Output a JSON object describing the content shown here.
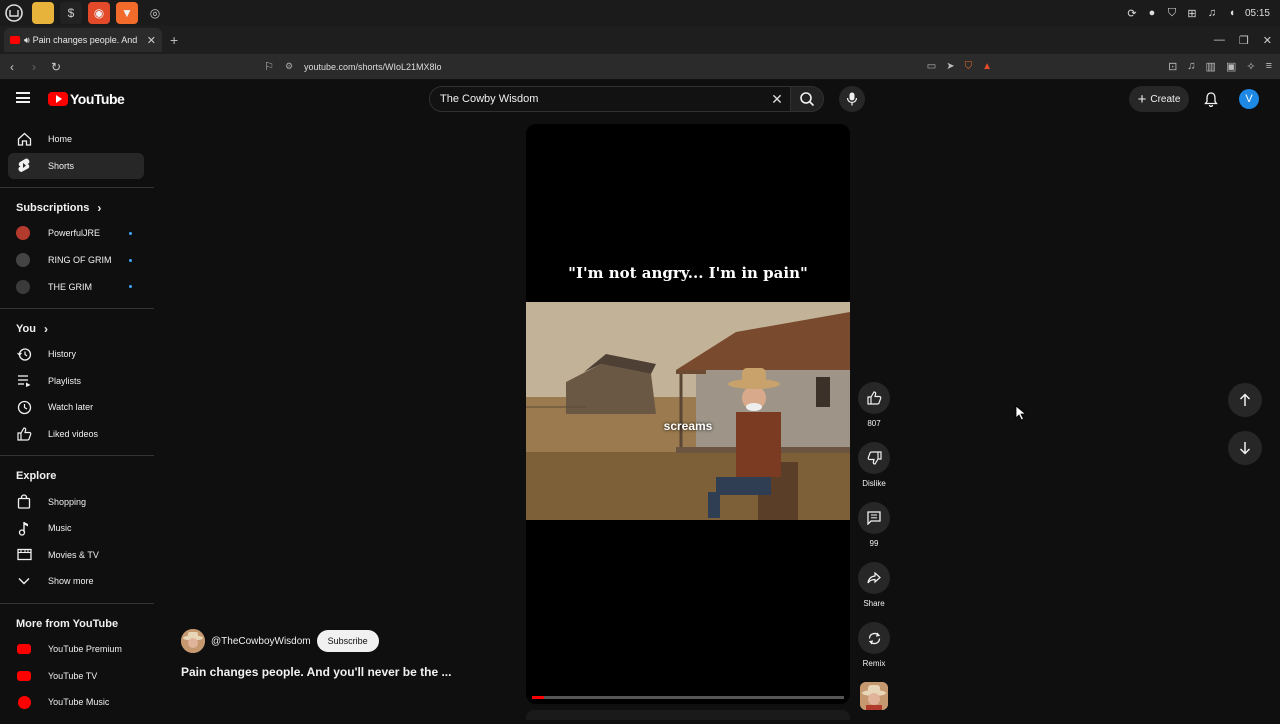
{
  "os": {
    "time": "05:15",
    "launcher_icon": "mint-logo-icon",
    "apps": [
      "folder-icon",
      "terminal-icon",
      "app-icon",
      "brave-icon",
      "chromium-icon"
    ]
  },
  "browser": {
    "tab_title": "Pain changes people. And",
    "url": "youtube.com/shorts/WIoL21MX8lo",
    "new_tab": "+"
  },
  "header": {
    "logo_text": "YouTube",
    "search_value": "The Cowby Wisdom",
    "create_label": "Create",
    "avatar_letter": "V"
  },
  "sidebar": {
    "main": [
      {
        "label": "Home",
        "icon": "home-icon"
      },
      {
        "label": "Shorts",
        "icon": "shorts-icon"
      }
    ],
    "subs_heading": "Subscriptions",
    "subs": [
      {
        "label": "PowerfulJRE",
        "color": "#b33a2c"
      },
      {
        "label": "RING OF GRIM",
        "color": "#444444"
      },
      {
        "label": "THE GRIM",
        "color": "#3a3a3a"
      }
    ],
    "you_heading": "You",
    "you": [
      {
        "label": "History",
        "icon": "history-icon"
      },
      {
        "label": "Playlists",
        "icon": "playlists-icon"
      },
      {
        "label": "Watch later",
        "icon": "clock-icon"
      },
      {
        "label": "Liked videos",
        "icon": "thumbs-up-icon"
      }
    ],
    "explore_heading": "Explore",
    "explore": [
      {
        "label": "Shopping",
        "icon": "bag-icon"
      },
      {
        "label": "Music",
        "icon": "music-icon"
      },
      {
        "label": "Movies & TV",
        "icon": "film-icon"
      },
      {
        "label": "Show more",
        "icon": "chevron-down-icon"
      }
    ],
    "more_heading": "More from YouTube",
    "more": [
      {
        "label": "YouTube Premium"
      },
      {
        "label": "YouTube TV"
      },
      {
        "label": "YouTube Music"
      }
    ]
  },
  "short": {
    "quote": "\"I'm not angry... I'm in pain\"",
    "caption": "screams",
    "progress": 0.04,
    "channel": "@TheCowboyWisdom",
    "subscribe": "Subscribe",
    "title": "Pain changes people. And you'll never be the ..."
  },
  "actions": {
    "likes": "807",
    "dislike": "Dislike",
    "comments": "99",
    "share": "Share",
    "remix": "Remix"
  },
  "colors": {
    "brand_red": "#ff0000",
    "bg": "#0f0f0f",
    "accent_blue": "#3ea6ff"
  }
}
